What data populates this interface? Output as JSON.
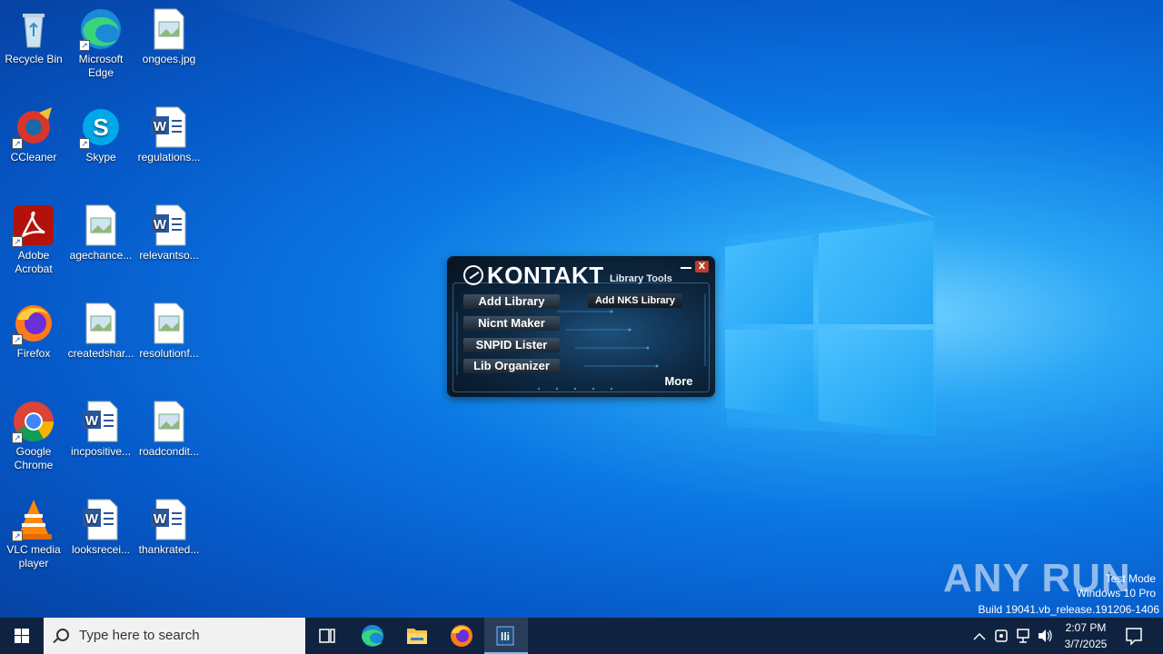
{
  "desktop": {
    "icons": [
      {
        "label": "Recycle Bin",
        "icon": "recycle-bin-icon"
      },
      {
        "label": "Microsoft Edge",
        "icon": "edge-icon"
      },
      {
        "label": "ongoes.jpg",
        "icon": "image-file-icon"
      },
      {
        "label": "CCleaner",
        "icon": "ccleaner-icon"
      },
      {
        "label": "Skype",
        "icon": "skype-icon"
      },
      {
        "label": "regulations...",
        "icon": "word-doc-icon"
      },
      {
        "label": "Adobe Acrobat",
        "icon": "acrobat-icon"
      },
      {
        "label": "agechance...",
        "icon": "image-file-icon"
      },
      {
        "label": "relevantso...",
        "icon": "word-doc-icon"
      },
      {
        "label": "Firefox",
        "icon": "firefox-icon"
      },
      {
        "label": "createdshar...",
        "icon": "image-file-icon"
      },
      {
        "label": "resolutionf...",
        "icon": "image-file-icon"
      },
      {
        "label": "Google Chrome",
        "icon": "chrome-icon"
      },
      {
        "label": "incpositive...",
        "icon": "word-doc-icon"
      },
      {
        "label": "roadcondit...",
        "icon": "image-file-icon"
      },
      {
        "label": "VLC media player",
        "icon": "vlc-icon"
      },
      {
        "label": "looksrecei...",
        "icon": "word-doc-icon"
      },
      {
        "label": "thankrated...",
        "icon": "word-doc-icon"
      }
    ]
  },
  "kontakt": {
    "title": "KONTAKT",
    "subtitle": "Library Tools",
    "close_label": "X",
    "buttons": {
      "add_library": "Add Library",
      "add_nks_library": "Add NKS Library",
      "nicnt_maker": "Nicnt Maker",
      "snpid_lister": "SNPID Lister",
      "lib_organizer": "Lib Organizer",
      "more": "More"
    }
  },
  "watermark": {
    "brand": "ANY RUN",
    "mode": "Test Mode",
    "edition": "Windows 10 Pro",
    "build": "Build 19041.vb_release.191206-1406"
  },
  "taskbar": {
    "search_placeholder": "Type here to search",
    "apps": [
      "task-view-icon",
      "edge-icon",
      "file-explorer-icon",
      "firefox-icon",
      "kontakt-tool-icon"
    ],
    "time": "2:07 PM",
    "date": "3/7/2025",
    "colors": {
      "taskbar": "#0f2340",
      "accent": "#0078d7"
    }
  }
}
